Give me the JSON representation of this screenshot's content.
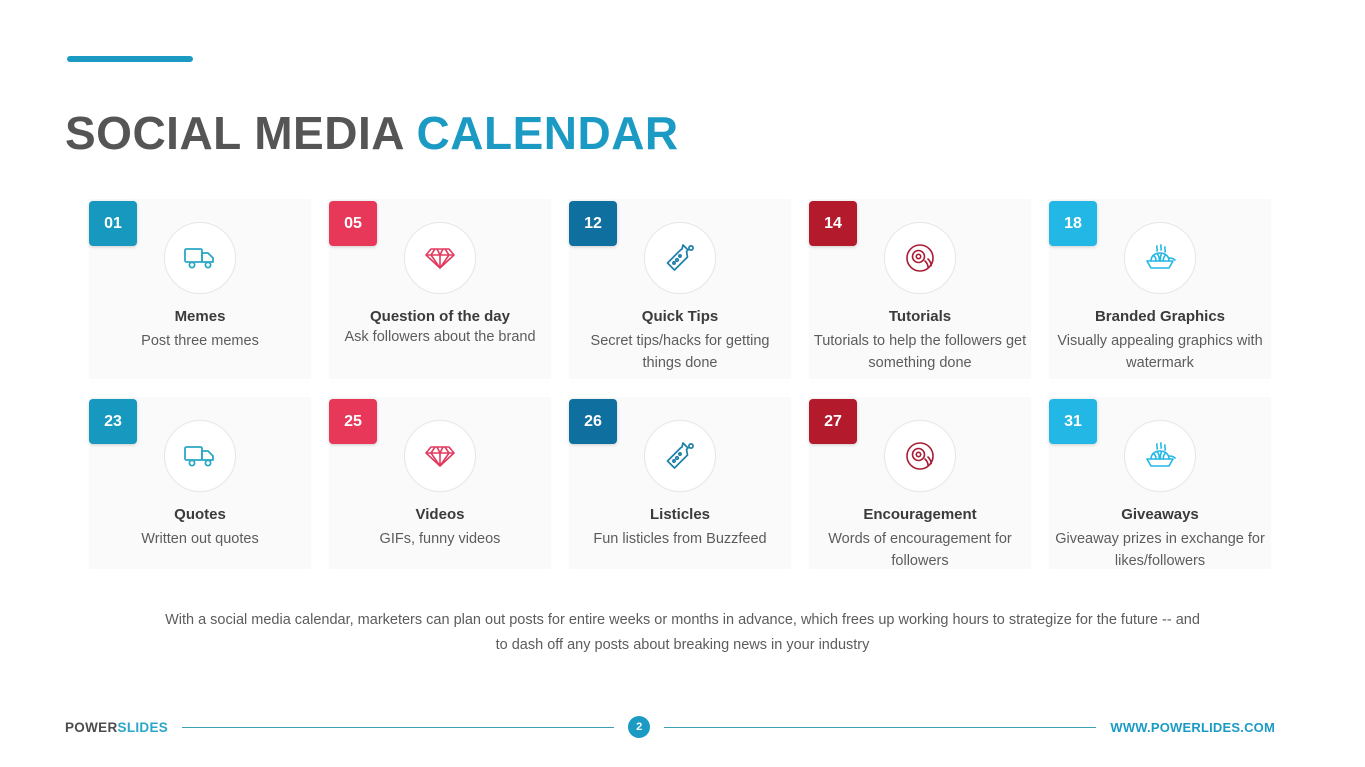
{
  "header": {
    "title_part1": "SOCIAL MEDIA",
    "title_part2": "CALENDAR",
    "accent_color": "#1b9bc4",
    "dark_color": "#555555"
  },
  "cards": [
    {
      "number": "01",
      "title": "Memes",
      "desc": "Post three memes",
      "icon": "delivery-truck-icon",
      "badge_color": "#1698bf",
      "icon_color": "#2aa8c4"
    },
    {
      "number": "05",
      "title": "Question of the day",
      "desc": "Ask followers about the brand",
      "icon": "diamond-icon",
      "badge_color": "#e8385a",
      "icon_color": "#e23a5e"
    },
    {
      "number": "12",
      "title": "Quick Tips",
      "desc": "Secret tips/hacks for getting things done",
      "icon": "flask-icon",
      "badge_color": "#0f6f9e",
      "icon_color": "#1d7fa8"
    },
    {
      "number": "14",
      "title": "Tutorials",
      "desc": "Tutorials to help the followers get something done",
      "icon": "compact-disc-icon",
      "badge_color": "#b31b2c",
      "icon_color": "#a81d35"
    },
    {
      "number": "18",
      "title": "Branded Graphics",
      "desc": "Visually appealing graphics with watermark",
      "icon": "steaming-bowl-icon",
      "badge_color": "#23b7e5",
      "icon_color": "#23b7e5"
    },
    {
      "number": "23",
      "title": "Quotes",
      "desc": "Written out quotes",
      "icon": "delivery-truck-icon",
      "badge_color": "#1698bf",
      "icon_color": "#2aa8c4"
    },
    {
      "number": "25",
      "title": "Videos",
      "desc": "GIFs, funny videos",
      "icon": "diamond-icon",
      "badge_color": "#e8385a",
      "icon_color": "#e23a5e"
    },
    {
      "number": "26",
      "title": "Listicles",
      "desc": "Fun listicles from Buzzfeed",
      "icon": "flask-icon",
      "badge_color": "#0f6f9e",
      "icon_color": "#1d7fa8"
    },
    {
      "number": "27",
      "title": "Encouragement",
      "desc": "Words of encouragement for followers",
      "icon": "compact-disc-icon",
      "badge_color": "#b31b2c",
      "icon_color": "#a81d35"
    },
    {
      "number": "31",
      "title": "Giveaways",
      "desc": "Giveaway prizes in exchange for likes/followers",
      "icon": "steaming-bowl-icon",
      "badge_color": "#23b7e5",
      "icon_color": "#23b7e5"
    }
  ],
  "caption": "With a social media calendar, marketers can plan out posts for entire weeks or months in advance, which frees up working hours to strategize for the future -- and to dash off any posts about breaking news in your industry",
  "footer": {
    "brand_part1": "POWER",
    "brand_part2": "SLIDES",
    "page_number": "2",
    "website": "WWW.POWERLIDES.COM"
  }
}
